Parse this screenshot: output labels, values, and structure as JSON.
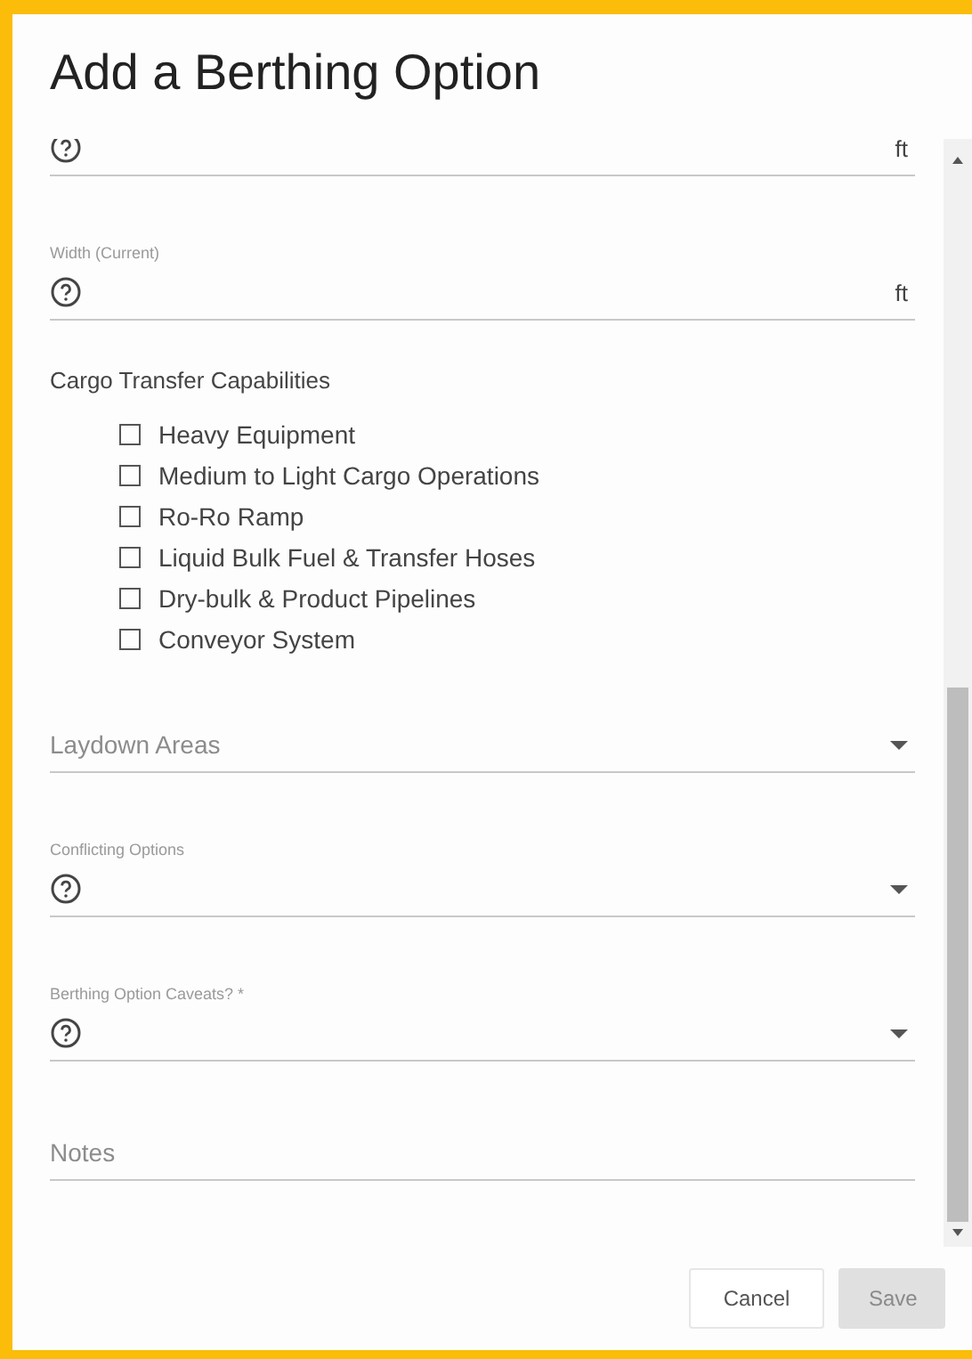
{
  "dialog": {
    "title": "Add a Berthing Option"
  },
  "fields": [
    {
      "kind": "unit",
      "help": true,
      "unit": "ft"
    },
    {
      "kind": "unit",
      "label": "Width (Current)",
      "help": true,
      "unit": "ft"
    },
    {
      "kind": "checkgroup",
      "label": "Cargo Transfer Capabilities",
      "options": [
        {
          "label": "Heavy Equipment",
          "checked": false
        },
        {
          "label": "Medium to Light Cargo Operations",
          "checked": false
        },
        {
          "label": "Ro-Ro Ramp",
          "checked": false
        },
        {
          "label": "Liquid Bulk Fuel & Transfer Hoses",
          "checked": false
        },
        {
          "label": "Dry-bulk & Product Pipelines",
          "checked": false
        },
        {
          "label": "Conveyor System",
          "checked": false
        }
      ]
    },
    {
      "kind": "select",
      "placeholder": "Laydown Areas",
      "help": false
    },
    {
      "kind": "select",
      "label": "Conflicting Options",
      "help": true
    },
    {
      "kind": "select",
      "label": "Berthing Option Caveats? *",
      "help": true
    },
    {
      "kind": "text",
      "placeholder": "Notes"
    }
  ],
  "buttons": [
    {
      "label": "Cancel",
      "disabled": false
    },
    {
      "label": "Save",
      "disabled": true
    }
  ]
}
